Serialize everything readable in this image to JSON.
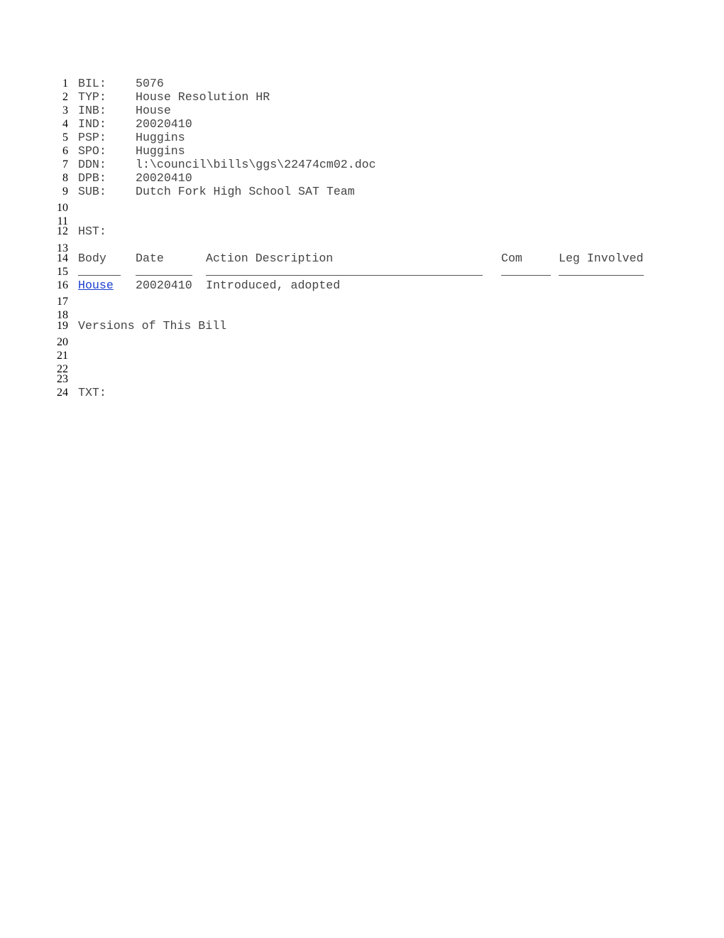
{
  "document": {
    "fields": [
      {
        "line": "1",
        "label": "BIL:",
        "value": "5076"
      },
      {
        "line": "2",
        "label": "TYP:",
        "value": "House Resolution HR"
      },
      {
        "line": "3",
        "label": "INB:",
        "value": "House"
      },
      {
        "line": "4",
        "label": "IND:",
        "value": "20020410"
      },
      {
        "line": "5",
        "label": "PSP:",
        "value": "Huggins"
      },
      {
        "line": "6",
        "label": "SPO:",
        "value": "Huggins"
      },
      {
        "line": "7",
        "label": "DDN:",
        "value": "l:\\council\\bills\\ggs\\22474cm02.doc"
      },
      {
        "line": "8",
        "label": "DPB:",
        "value": "20020410"
      },
      {
        "line": "9",
        "label": "SUB:",
        "value": "Dutch Fork High School SAT Team"
      }
    ],
    "empty_lines": [
      "10",
      "11",
      "13",
      "17",
      "18",
      "20",
      "21",
      "22",
      "23"
    ],
    "history": {
      "line": "12",
      "label": "HST:",
      "header_line": "14",
      "rule_line": "15",
      "columns": {
        "body": "Body",
        "date": "Date",
        "action": "Action Description",
        "com": "Com",
        "leg": "Leg Involved"
      },
      "rows": [
        {
          "line": "16",
          "body": "House",
          "date": "20020410",
          "action": "Introduced, adopted",
          "com": "",
          "leg": ""
        }
      ]
    },
    "versions": {
      "line": "19",
      "label": "Versions of This Bill"
    },
    "text": {
      "line": "24",
      "label": "TXT:"
    },
    "colors": {
      "link": "#1a3fcf",
      "text": "#444444",
      "line_numbers": "#000000"
    }
  }
}
